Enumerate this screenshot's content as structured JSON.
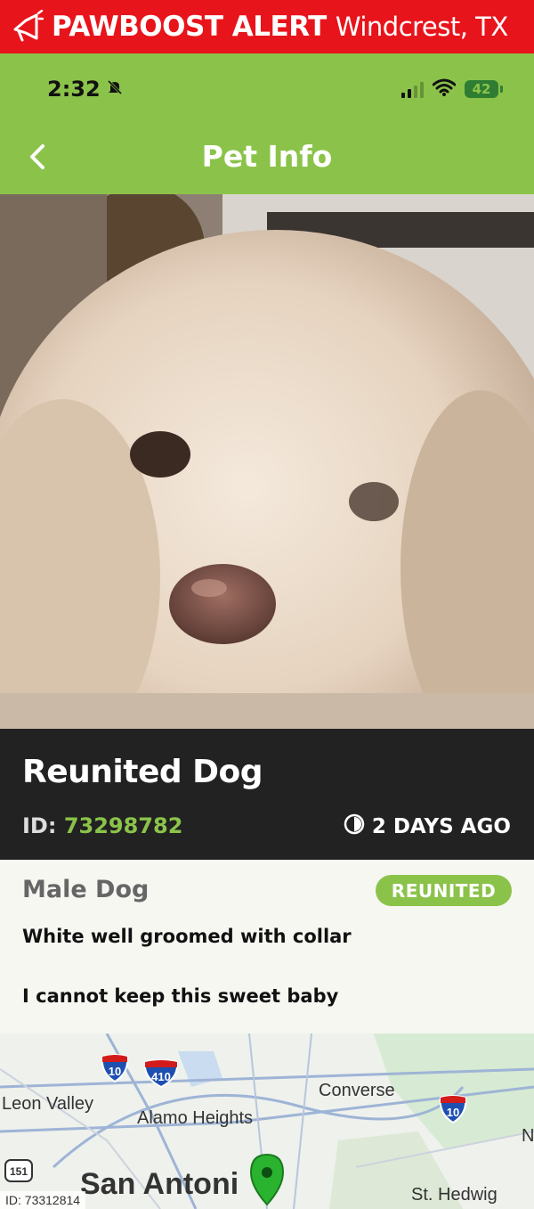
{
  "banner": {
    "title": "PAWBOOST ALERT",
    "location": "Windcrest, TX",
    "color": "#e8141b"
  },
  "status": {
    "time": "2:32",
    "battery": "42"
  },
  "appbar": {
    "title": "Pet Info",
    "color": "#8bc34a"
  },
  "pet": {
    "title": "Reunited Dog",
    "id_label": "ID:",
    "id_value": "73298782",
    "posted_ago": "2 DAYS AGO",
    "sex_species": "Male Dog",
    "status_badge": "REUNITED",
    "description_line1": "White well groomed with collar",
    "description_line2": "I cannot keep this sweet baby"
  },
  "map": {
    "labels": {
      "leon_valley": "Leon Valley",
      "alamo_heights": "Alamo Heights",
      "converse": "Converse",
      "san_antonio": "San Antoni",
      "st_hedwig": "St. Hedwig",
      "n": "N"
    },
    "shields": {
      "i10_left": "10",
      "i410": "410",
      "i10_right": "10",
      "r151": "151"
    },
    "id_tag": "ID: 73312814"
  }
}
